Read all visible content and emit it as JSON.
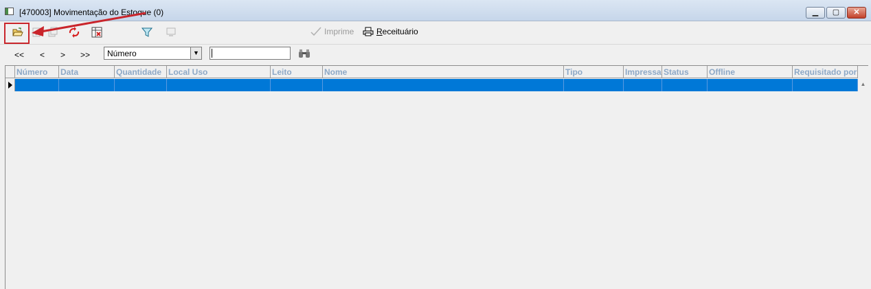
{
  "window": {
    "title": "[470003]  Movimentação do Estoque (0)",
    "controls": {
      "minimize": "▭",
      "maximize": "□",
      "close": "✕"
    }
  },
  "toolbar": {
    "icons": [
      {
        "name": "open-folder-icon",
        "glyph": "📂",
        "color": "#c8a020"
      },
      {
        "name": "edit-disabled-icon",
        "glyph": "✎",
        "color": "#b0b0b0"
      },
      {
        "name": "copy-disabled-icon",
        "glyph": "⧉",
        "color": "#b0b0b0"
      },
      {
        "name": "refresh-icon",
        "glyph": "↻",
        "color": "#d62020"
      },
      {
        "name": "grid-delete-icon",
        "glyph": "▦",
        "color": "#c02020"
      },
      {
        "name": "filter-icon",
        "glyph": "⏷",
        "color": "#1e9bc8"
      },
      {
        "name": "monitor-disabled-icon",
        "glyph": "▣",
        "color": "#b0b0b0"
      }
    ],
    "imprime_label": "Imprime",
    "receituario_label": "Receituário"
  },
  "navigation": {
    "first": "<<",
    "prev": "<",
    "next": ">",
    "last": ">>",
    "search_field_selected": "Número",
    "search_value": ""
  },
  "grid": {
    "columns": [
      "Número",
      "Data",
      "Quantidade",
      "Local Uso",
      "Leito",
      "Nome",
      "Tipo",
      "Impressa",
      "Status",
      "Offline",
      "Requisitado por"
    ],
    "selection_color": "#0078d7",
    "header_text_color": "#8da8c6"
  },
  "annotation": {
    "highlight_color": "#c9252b"
  }
}
